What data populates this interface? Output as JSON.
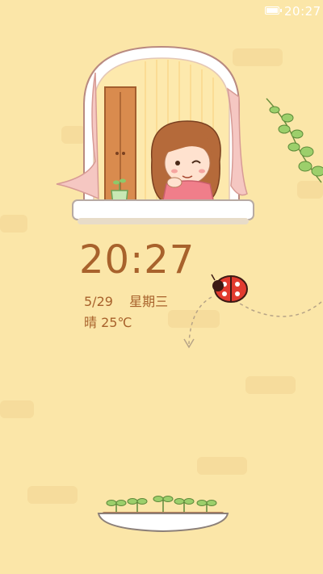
{
  "status_bar": {
    "time": "20:27"
  },
  "lockscreen": {
    "time": "20:27",
    "date": "5/29",
    "weekday": "星期三",
    "weather": "晴 25℃"
  },
  "icons": {
    "battery": "battery-icon"
  }
}
